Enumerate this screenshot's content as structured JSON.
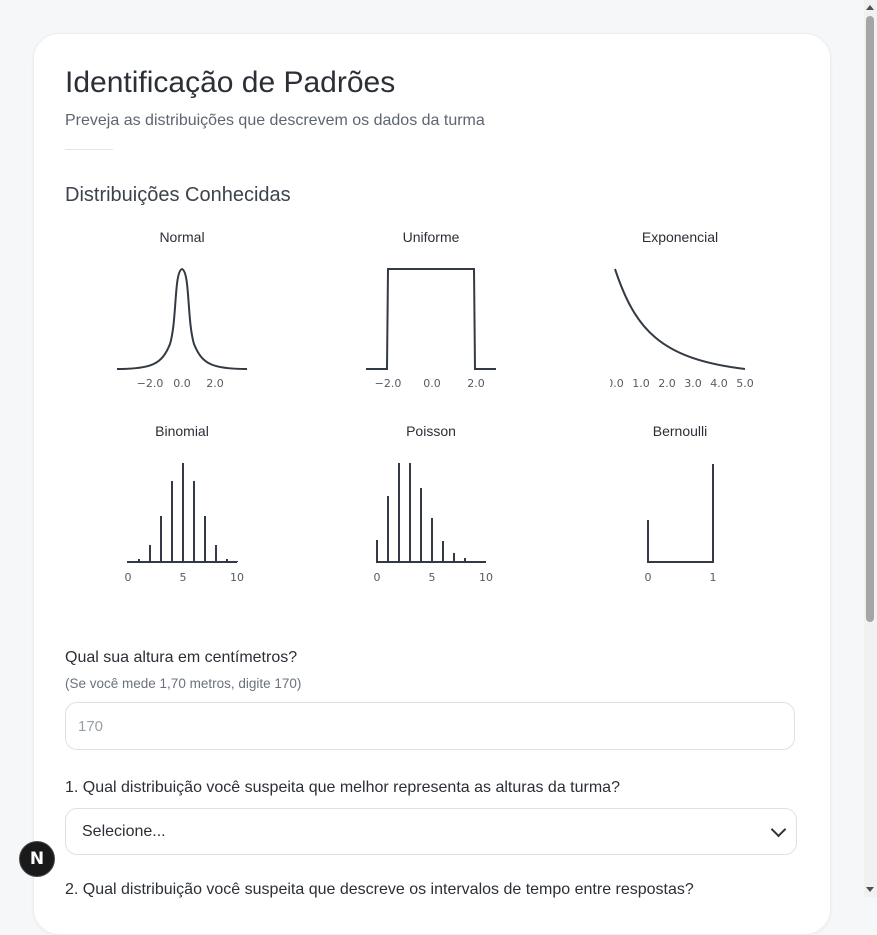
{
  "header": {
    "title": "Identificação de Padrões",
    "subtitle": "Preveja as distribuições que descrevem os dados da turma"
  },
  "known": {
    "heading": "Distribuições Conhecidas",
    "items": [
      {
        "label": "Normal",
        "ticks": [
          "−2.0",
          "0.0",
          "2.0"
        ]
      },
      {
        "label": "Uniforme",
        "ticks": [
          "−2.0",
          "0.0",
          "2.0"
        ]
      },
      {
        "label": "Exponencial",
        "ticks": [
          "0.0",
          "1.0",
          "2.0",
          "3.0",
          "4.0",
          "5.0"
        ]
      },
      {
        "label": "Binomial",
        "ticks": [
          "0",
          "5",
          "10"
        ]
      },
      {
        "label": "Poisson",
        "ticks": [
          "0",
          "5",
          "10"
        ]
      },
      {
        "label": "Bernoulli",
        "ticks": [
          "0",
          "1"
        ]
      }
    ]
  },
  "form": {
    "height_question": "Qual sua altura em centímetros?",
    "height_hint": "(Se você mede 1,70 metros, digite 170)",
    "height_placeholder": "170",
    "q1": "1. Qual distribuição você suspeita que melhor representa as alturas da turma?",
    "q1_select": "Selecione...",
    "q2": "2. Qual distribuição você suspeita que descreve os intervalos de tempo entre respostas?"
  },
  "badge": "N",
  "colors": {
    "curve": "#333a44",
    "page_bg": "#f6f7f8",
    "card_bg": "#ffffff"
  }
}
